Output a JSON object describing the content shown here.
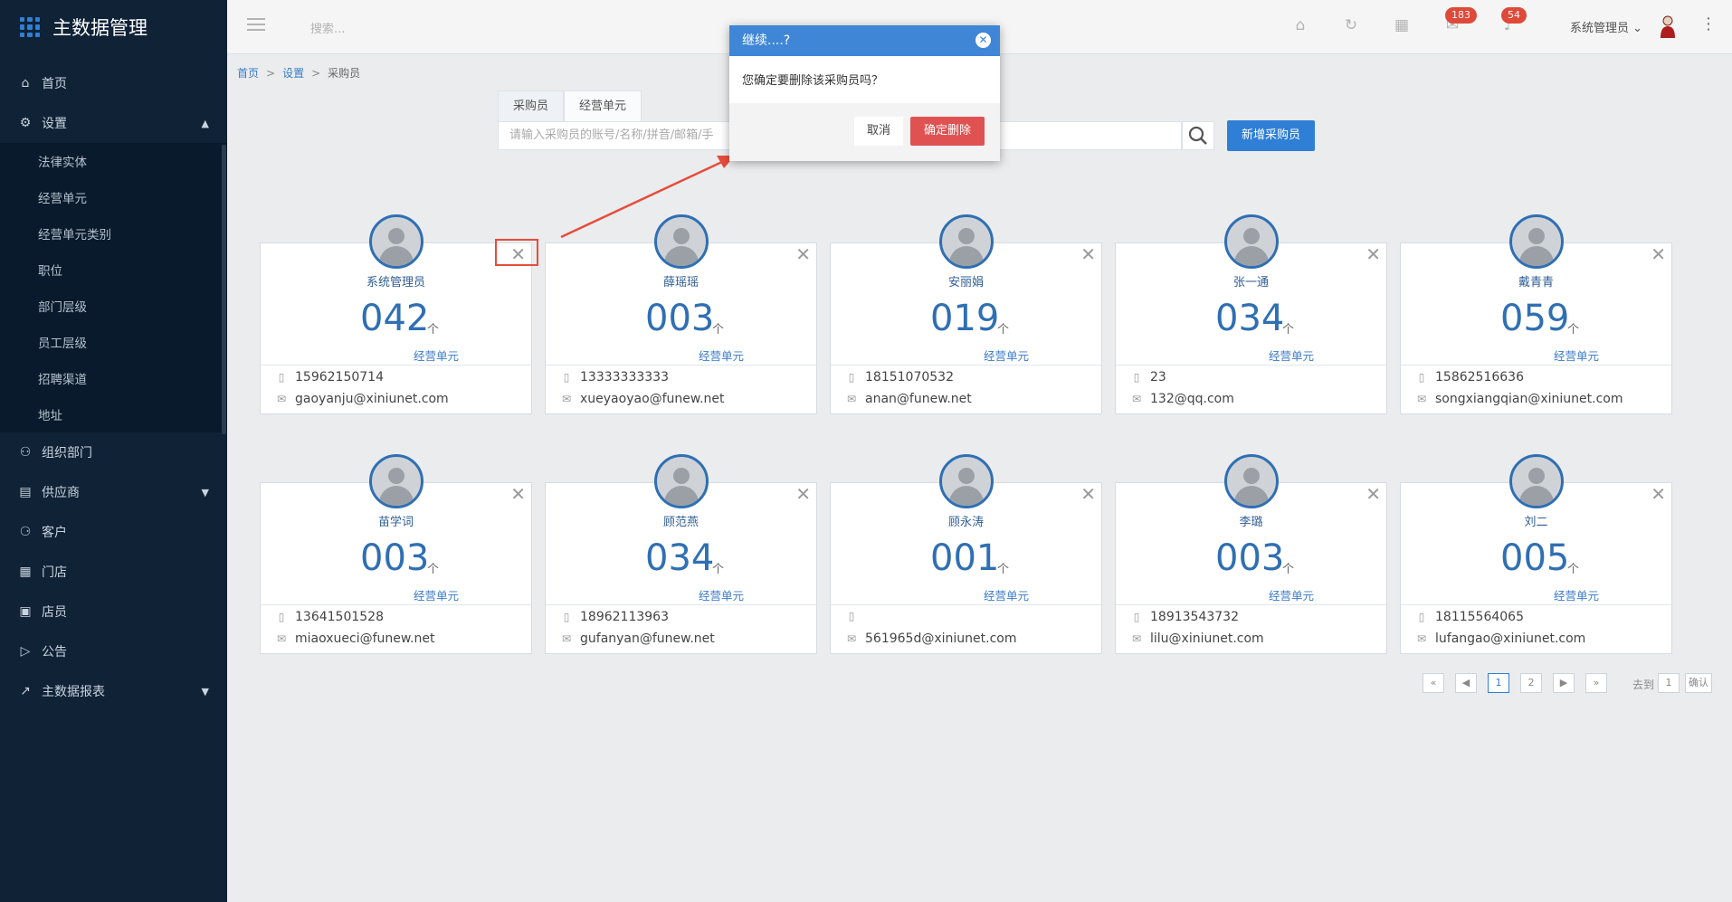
{
  "app": {
    "title": "主数据管理"
  },
  "sidebar": {
    "items": [
      {
        "label": "首页",
        "icon": "home-icon"
      },
      {
        "label": "设置",
        "icon": "gear-icon",
        "expanded": true
      },
      {
        "label": "组织部门",
        "icon": "org-icon"
      },
      {
        "label": "供应商",
        "icon": "supplier-icon"
      },
      {
        "label": "客户",
        "icon": "customer-icon"
      },
      {
        "label": "门店",
        "icon": "store-icon"
      },
      {
        "label": "店员",
        "icon": "clerk-icon"
      },
      {
        "label": "公告",
        "icon": "notice-icon"
      },
      {
        "label": "主数据报表",
        "icon": "chart-icon"
      }
    ],
    "settings_sub": [
      "法律实体",
      "经营单元",
      "经营单元类别",
      "职位",
      "部门层级",
      "员工层级",
      "招聘渠道",
      "地址"
    ]
  },
  "topbar": {
    "search_placeholder": "搜索...",
    "badge_messages": "183",
    "badge_notifications": "54",
    "user": "系统管理员"
  },
  "breadcrumb": {
    "home": "首页",
    "settings": "设置",
    "current": "采购员",
    "sep": ">"
  },
  "tabs": [
    "采购员",
    "经营单元"
  ],
  "search": {
    "placeholder": "请输入采购员的账号/名称/拼音/邮箱/手"
  },
  "add_button": "新增采购员",
  "unit_label": "经营单元",
  "unit_arrow": "个",
  "cards": [
    {
      "name": "系统管理员",
      "count": "042",
      "phone": "15962150714",
      "email": "gaoyanju@xiniunet.com"
    },
    {
      "name": "薛瑶瑶",
      "count": "003",
      "phone": "13333333333",
      "email": "xueyaoyao@funew.net"
    },
    {
      "name": "安丽娟",
      "count": "019",
      "phone": "18151070532",
      "email": "anan@funew.net"
    },
    {
      "name": "张一通",
      "count": "034",
      "phone": "23",
      "email": "132@qq.com"
    },
    {
      "name": "戴青青",
      "count": "059",
      "phone": "15862516636",
      "email": "songxiangqian@xiniunet.com"
    },
    {
      "name": "苗学词",
      "count": "003",
      "phone": "13641501528",
      "email": "miaoxueci@funew.net"
    },
    {
      "name": "顾范燕",
      "count": "034",
      "phone": "18962113963",
      "email": "gufanyan@funew.net"
    },
    {
      "name": "顾永涛",
      "count": "001",
      "phone": "",
      "email": "561965d@xiniunet.com"
    },
    {
      "name": "李璐",
      "count": "003",
      "phone": "18913543732",
      "email": "lilu@xiniunet.com"
    },
    {
      "name": "刘二",
      "count": "005",
      "phone": "18115564065",
      "email": "lufangao@xiniunet.com"
    }
  ],
  "pagination": {
    "first": "«",
    "prev": "◀",
    "pages": [
      "1",
      "2"
    ],
    "next": "▶",
    "last": "»",
    "goto_label": "去到",
    "goto_value": "1",
    "confirm": "确认"
  },
  "modal": {
    "title": "继续....?",
    "message": "您确定要删除该采购员吗？",
    "cancel": "取消",
    "confirm": "确定删除"
  },
  "colors": {
    "sidebar": "#0f2236",
    "accent": "#2f7fd6",
    "danger": "#e05252",
    "modal_header": "#3f86d6"
  }
}
